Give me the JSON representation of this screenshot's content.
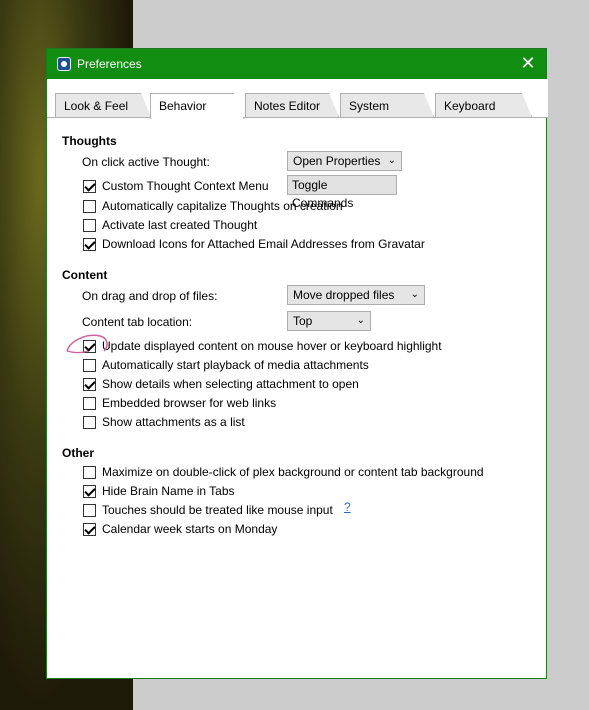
{
  "window": {
    "title": "Preferences",
    "close_glyph": "✕"
  },
  "tabs": [
    {
      "label": "Look & Feel"
    },
    {
      "label": "Behavior"
    },
    {
      "label": "Notes Editor"
    },
    {
      "label": "System"
    },
    {
      "label": "Keyboard"
    }
  ],
  "active_tab": "Behavior",
  "thoughts": {
    "title": "Thoughts",
    "on_click_label": "On click active Thought:",
    "on_click_value": "Open Properties",
    "context_menu": {
      "label": "Custom Thought Context Menu",
      "checked": true
    },
    "toggle_commands": "Toggle Commands",
    "capitalize": {
      "label": "Automatically capitalize Thoughts on creation",
      "checked": false
    },
    "activate_last": {
      "label": "Activate last created Thought",
      "checked": false
    },
    "gravatar": {
      "label": "Download Icons for Attached Email Addresses from Gravatar",
      "checked": true
    }
  },
  "content": {
    "title": "Content",
    "drag_drop_label": "On drag and drop of files:",
    "drag_drop_value": "Move dropped files",
    "tab_location_label": "Content tab location:",
    "tab_location_value": "Top",
    "update_hover": {
      "label": "Update displayed content on mouse hover or keyboard highlight",
      "checked": true
    },
    "autoplay": {
      "label": "Automatically start playback of media attachments",
      "checked": false
    },
    "show_details": {
      "label": "Show details when selecting attachment to open",
      "checked": true
    },
    "embedded_browser": {
      "label": "Embedded browser for web links",
      "checked": false
    },
    "attachments_list": {
      "label": "Show attachments as a list",
      "checked": false
    }
  },
  "other": {
    "title": "Other",
    "maximize": {
      "label": "Maximize on double-click of plex background or content tab background",
      "checked": false
    },
    "hide_brain": {
      "label": "Hide Brain Name in Tabs",
      "checked": true
    },
    "touches": {
      "label": "Touches should be treated like mouse input",
      "checked": false
    },
    "touches_help": "?",
    "calendar": {
      "label": "Calendar week starts on Monday",
      "checked": true
    }
  },
  "colors": {
    "titlebar": "#118d11",
    "help_link": "#1a6fc9",
    "annotation": "#d0609a"
  }
}
